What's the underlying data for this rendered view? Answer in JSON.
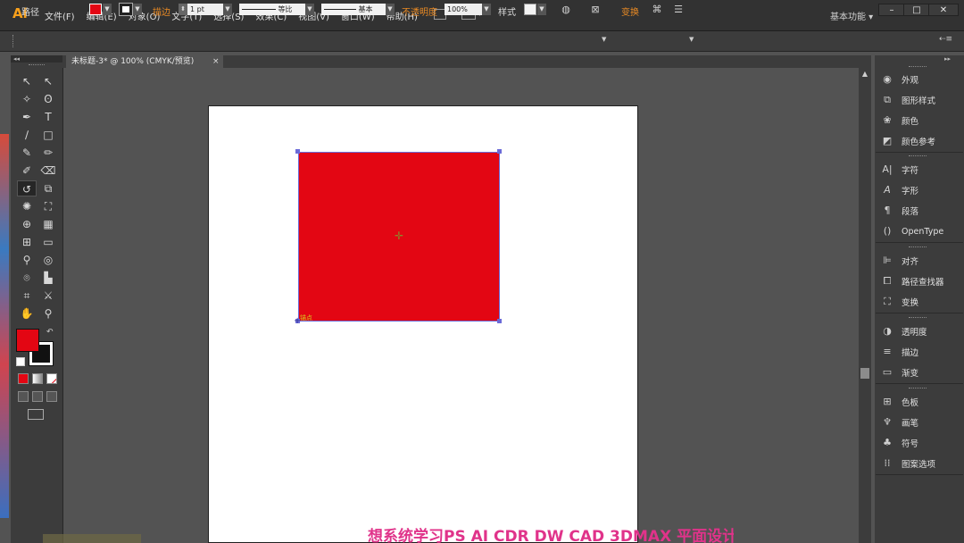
{
  "app": {
    "logo": "Ai",
    "menus": [
      "文件(F)",
      "编辑(E)",
      "对象(O)",
      "文字(T)",
      "选择(S)",
      "效果(C)",
      "视图(V)",
      "窗口(W)",
      "帮助(H)"
    ],
    "workspace": "基本功能",
    "window_buttons": [
      "–",
      "□",
      "✕"
    ]
  },
  "control_bar": {
    "selection_label": "路径",
    "fill_color": "#e30613",
    "stroke_label": "描边",
    "stroke_weight": "1 pt",
    "stroke_profile": "等比",
    "brush": "基本",
    "opacity_label": "不透明度",
    "opacity_value": "100%",
    "style_label": "样式",
    "transform_label": "变换"
  },
  "document": {
    "tab_title": "未标题-3* @ 100% (CMYK/预览)",
    "close": "×",
    "anchor_label": "锚点",
    "watermark": "想系统学习PS AI CDR DW CAD 3DMAX 平面设计"
  },
  "colors": {
    "accent_orange": "#e98a24",
    "artwork_red": "#e30613",
    "panel_bg": "#3c3c3c",
    "canvas_bg": "#535353"
  },
  "tools": [
    [
      "selection-tool-icon",
      "direct-selection-tool-icon"
    ],
    [
      "magic-wand-tool-icon",
      "lasso-tool-icon"
    ],
    [
      "pen-tool-icon",
      "type-tool-icon"
    ],
    [
      "line-segment-tool-icon",
      "rectangle-tool-icon"
    ],
    [
      "paintbrush-tool-icon",
      "pencil-tool-icon"
    ],
    [
      "blob-brush-tool-icon",
      "eraser-tool-icon"
    ],
    [
      "rotate-tool-icon",
      "scale-tool-icon"
    ],
    [
      "warp-tool-icon",
      "free-transform-tool-icon"
    ],
    [
      "shape-builder-tool-icon",
      "perspective-grid-tool-icon"
    ],
    [
      "mesh-tool-icon",
      "gradient-tool-icon"
    ],
    [
      "eyedropper-tool-icon",
      "blend-tool-icon"
    ],
    [
      "symbol-sprayer-tool-icon",
      "column-graph-tool-icon"
    ],
    [
      "artboard-tool-icon",
      "slice-tool-icon"
    ],
    [
      "hand-tool-icon",
      "zoom-tool-icon"
    ]
  ],
  "right_panel": {
    "group1": [
      "外观",
      "图形样式",
      "颜色",
      "颜色参考"
    ],
    "group2": [
      "字符",
      "字形",
      "段落",
      "OpenType"
    ],
    "group3": [
      "对齐",
      "路径查找器",
      "变换"
    ],
    "group4": [
      "透明度",
      "描边",
      "渐变"
    ],
    "group5": [
      "色板",
      "画笔",
      "符号",
      "图案选项"
    ]
  }
}
